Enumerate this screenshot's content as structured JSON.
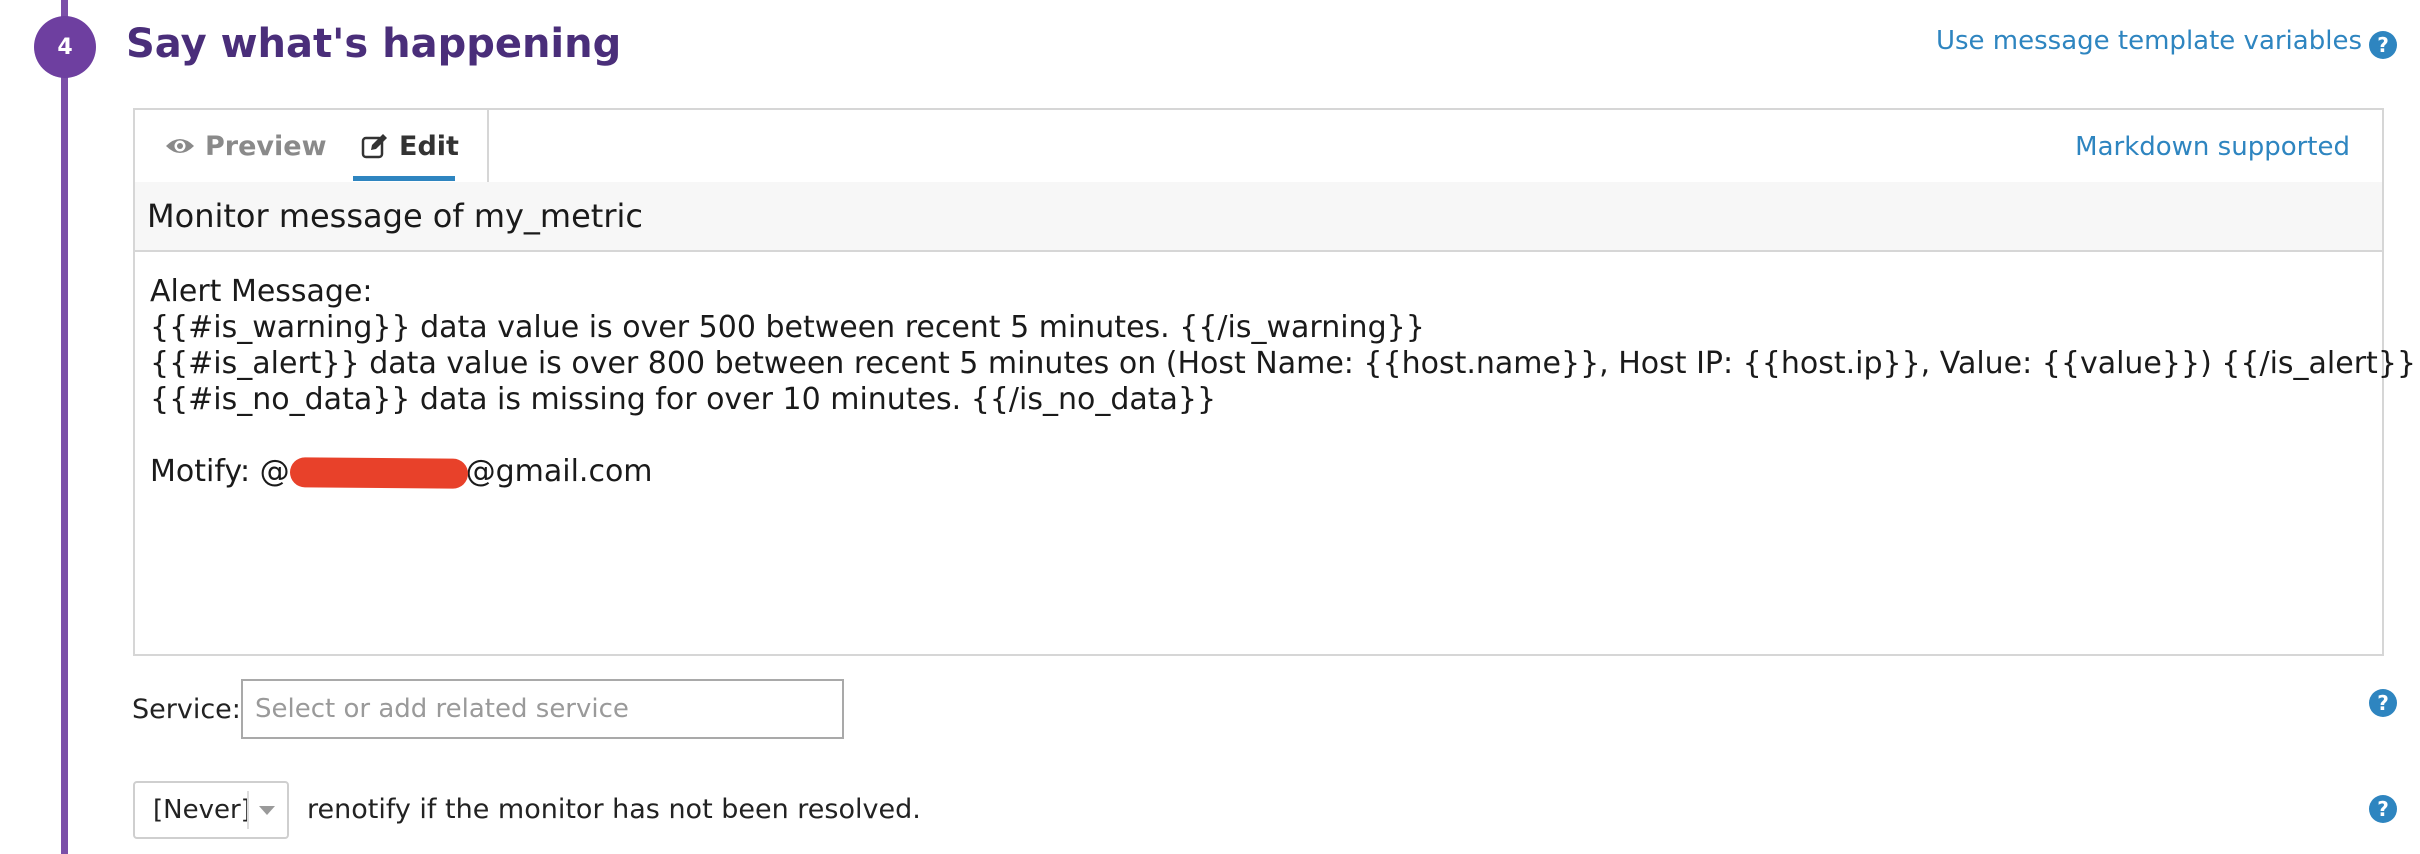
{
  "step": {
    "number": "4",
    "title": "Say what's happening",
    "template_link": "Use message template variables",
    "help_symbol": "?"
  },
  "editor": {
    "tabs": [
      {
        "label": "Preview",
        "icon": "eye-icon",
        "active": false
      },
      {
        "label": "Edit",
        "icon": "edit-icon",
        "active": true
      }
    ],
    "markdown_link": "Markdown supported",
    "title_value": "Monitor message of my_metric",
    "message_lines": [
      "Alert Message:",
      "{{#is_warning}} data value is over 500 between recent 5 minutes. {{/is_warning}}",
      "{{#is_alert}} data value is over 800 between recent 5 minutes on (Host Name: {{host.name}}, Host IP: {{host.ip}}, Value: {{value}}) {{/is_alert}}",
      "{{#is_no_data}} data is missing for over 10 minutes. {{/is_no_data}}",
      ""
    ],
    "notify_prefix": "Motify: @",
    "notify_suffix": "@gmail.com"
  },
  "service": {
    "label": "Service:",
    "placeholder": "Select or add related service",
    "value": ""
  },
  "renotify": {
    "selected": "[Never]",
    "text": "renotify if the monitor has not been resolved."
  },
  "colors": {
    "accent_purple": "#6e3fa0",
    "title_purple": "#4a2e7a",
    "link_blue": "#2e85c0",
    "redaction_red": "#e8412a"
  }
}
